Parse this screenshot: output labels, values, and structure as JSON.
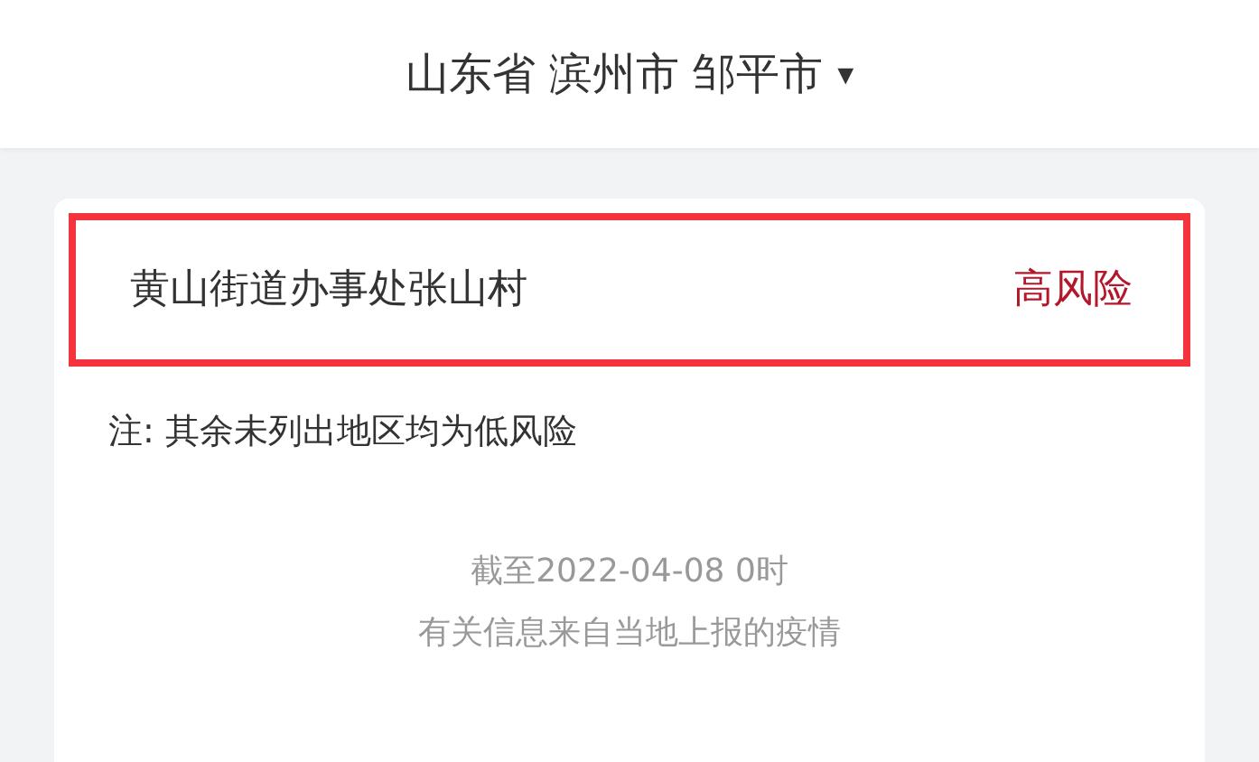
{
  "location": {
    "text": "山东省 滨州市 邹平市",
    "caret": "▾"
  },
  "areas": [
    {
      "name": "黄山街道办事处张山村",
      "risk": "高风险",
      "highlighted": true
    }
  ],
  "note": "注: 其余未列出地区均为低风险",
  "footer": [
    "截至2022-04-08 0时",
    "有关信息来自当地上报的疫情"
  ]
}
